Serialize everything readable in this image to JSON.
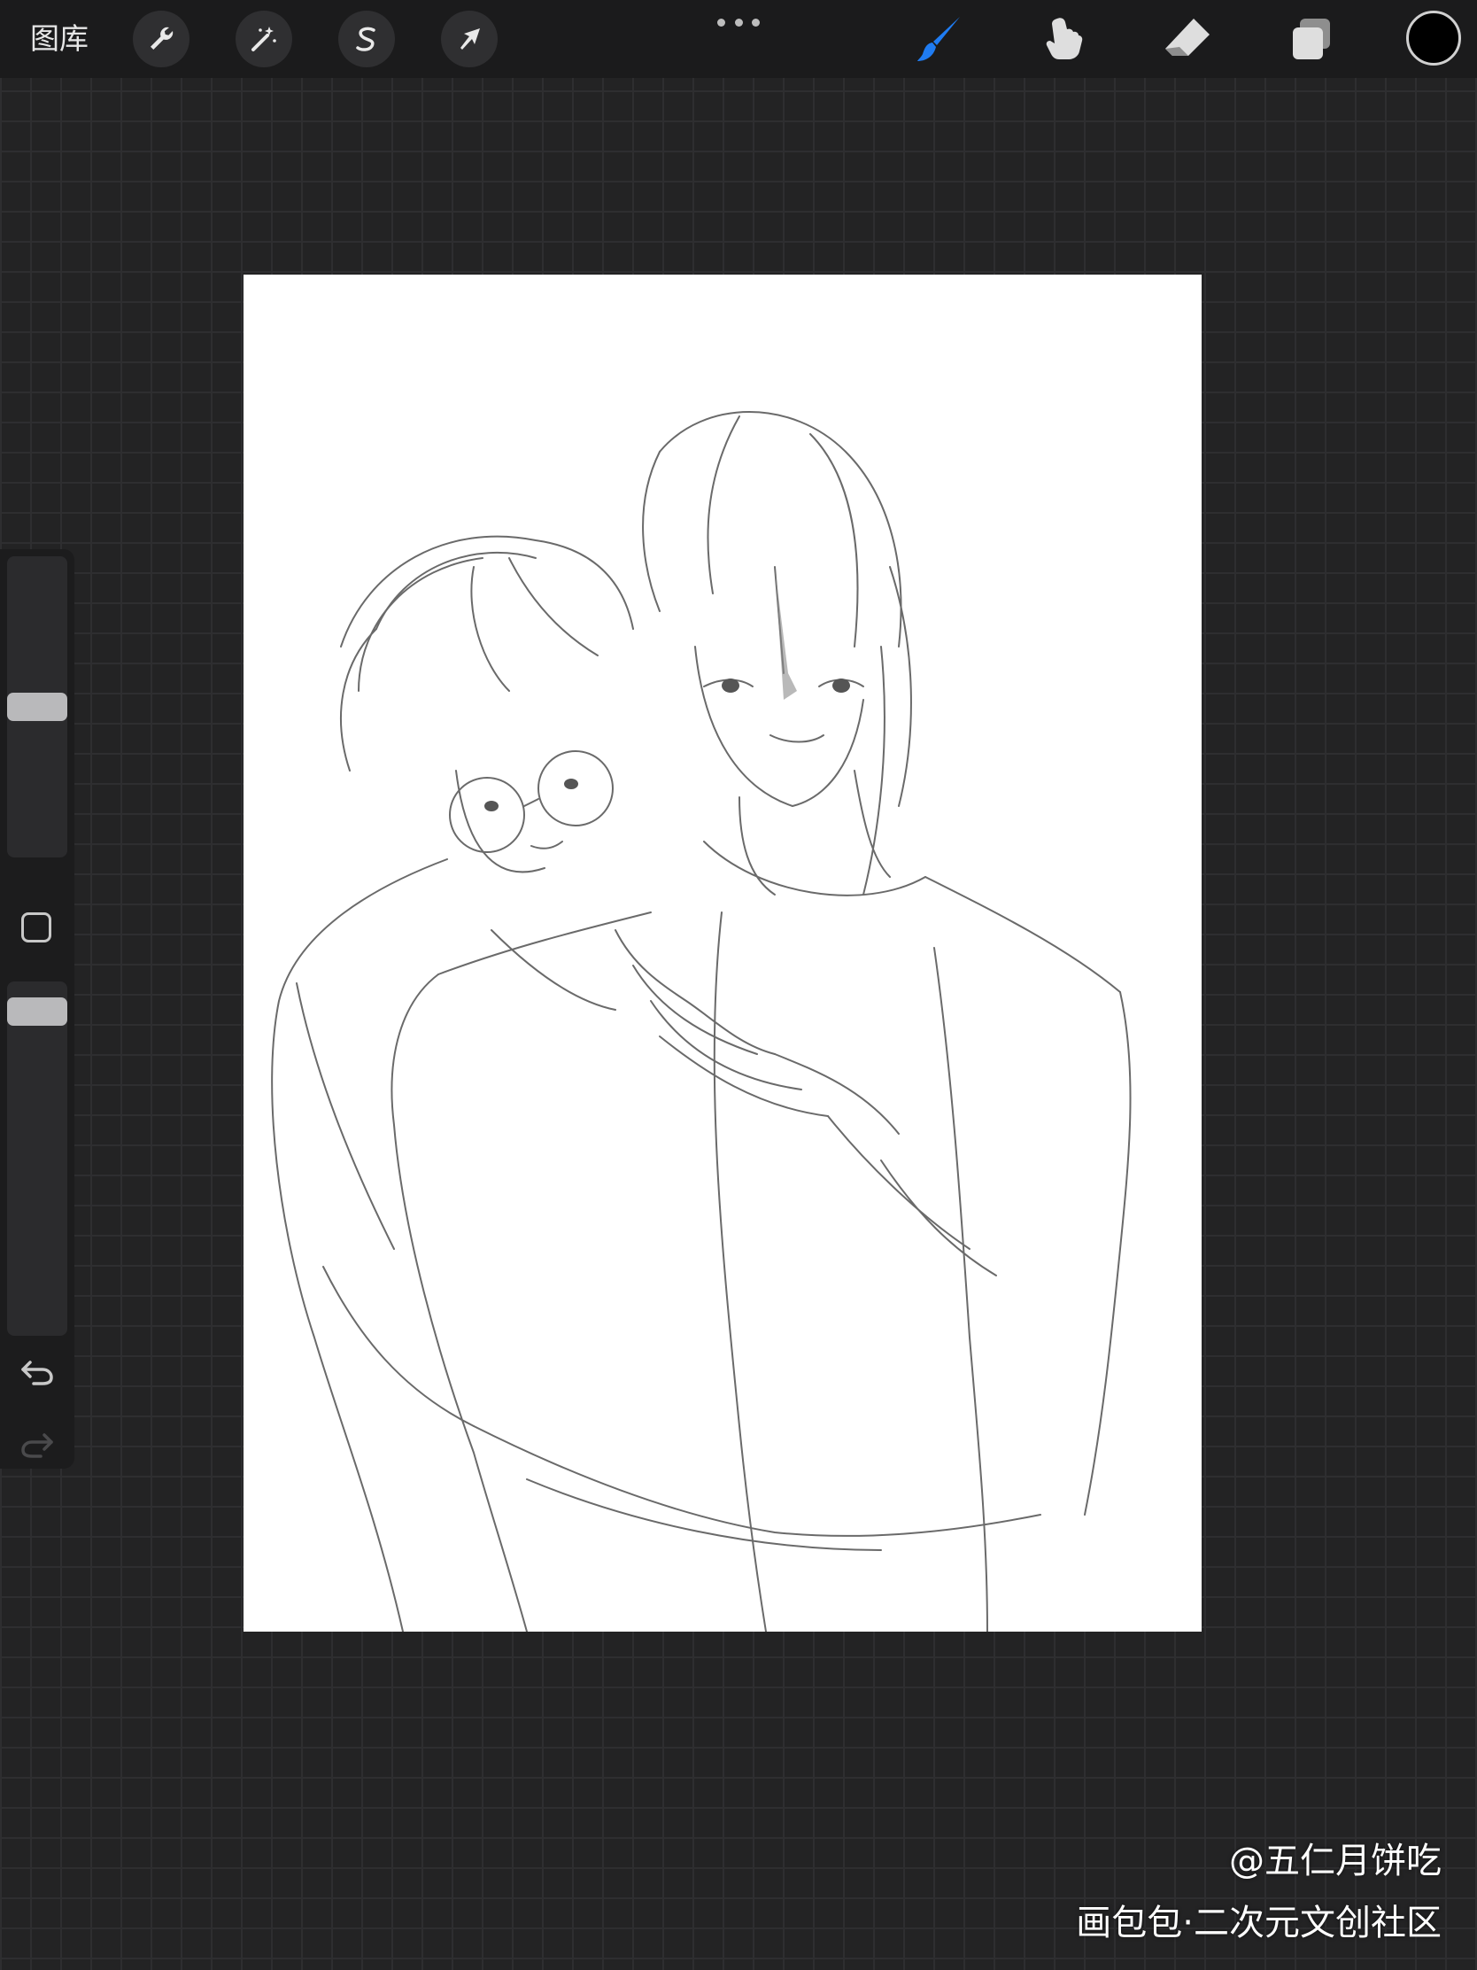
{
  "toolbar": {
    "gallery_label": "图库",
    "left_tools": [
      {
        "id": "actions",
        "icon": "wrench-icon"
      },
      {
        "id": "adjustments",
        "icon": "magic-wand-icon"
      },
      {
        "id": "selection",
        "icon": "selection-s-icon"
      },
      {
        "id": "transform",
        "icon": "arrow-cursor-icon"
      }
    ],
    "more_icon": "more-dots-icon",
    "right_tools": [
      {
        "id": "brush",
        "icon": "brush-icon",
        "active": true
      },
      {
        "id": "smudge",
        "icon": "smudge-finger-icon",
        "active": false
      },
      {
        "id": "eraser",
        "icon": "eraser-icon",
        "active": false
      },
      {
        "id": "layers",
        "icon": "layers-icon",
        "active": false
      }
    ],
    "current_color": "#000000",
    "accent_color": "#1f7cf2"
  },
  "sidebar": {
    "brush_size_level": 0.5,
    "opacity_level": 0.95,
    "undo_icon": "undo-arrow-icon",
    "redo_icon": "redo-arrow-icon",
    "modify_icon": "square-modify-icon"
  },
  "canvas": {
    "content": "pencil-line-sketch"
  },
  "watermark": {
    "author": "@五仁月饼吃",
    "site": "画包包·二次元文创社区"
  }
}
